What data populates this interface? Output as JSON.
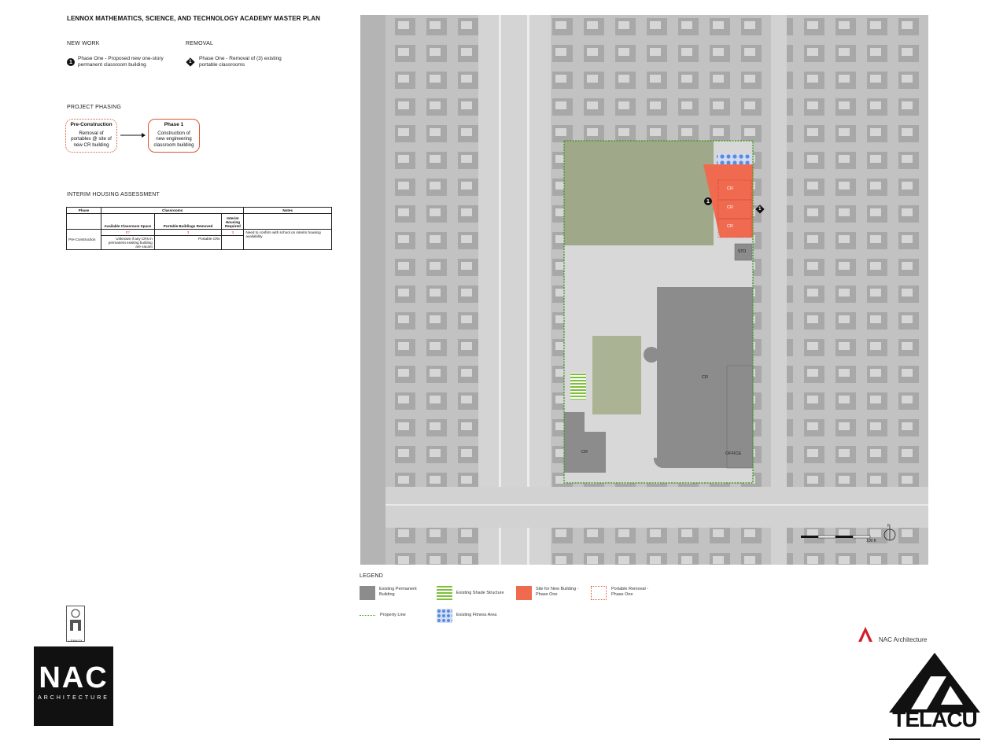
{
  "header": {
    "title": "LENNOX MATHEMATICS, SCIENCE, AND TECHNOLOGY ACADEMY MASTER PLAN"
  },
  "new_work": {
    "heading": "NEW WORK",
    "badge": "1",
    "text_line1": "Phase One - Proposed new one-story",
    "text_line2": "permanent classroom building"
  },
  "removal": {
    "heading": "REMOVAL",
    "badge": "1",
    "text_line1": "Phase One - Removal of (3) existing",
    "text_line2": "portable classrooms"
  },
  "phasing": {
    "heading": "PROJECT PHASING",
    "pre": {
      "title": "Pre-Construction",
      "line1": "Removal of",
      "line2": "portables @ site of",
      "line3": "new CR building"
    },
    "phase1": {
      "title": "Phase 1",
      "line1": "Construction of",
      "line2": "new engineering",
      "line3": "classroom building"
    }
  },
  "interim": {
    "heading": "INTERIM HOUSING ASSESSMENT",
    "col_phase": "Phase",
    "col_classrooms": "Classrooms",
    "col_notes": "Notes",
    "sub_available": "Available Classroom Space",
    "sub_removed": "Portable Buildings Removed",
    "sub_interim": "Interim Housing Required",
    "row_phase": "Pre-Construction",
    "row_available_count": "0?",
    "row_removed_count": "3",
    "row_interim_count": "3",
    "row_available_note": "Unknown if any CRs in permanent existing building are vacant",
    "row_removed_note": "Portable CRs",
    "row_notes": "Need to confirm with school on interim housing availability"
  },
  "map": {
    "labels": {
      "cr_portable1": "CR",
      "cr_portable2": "CR",
      "cr_portable3": "CR",
      "sto": "STO",
      "cr_main": "CR",
      "office": "OFFICE",
      "cr_small": "CR"
    },
    "badge_circle": "1",
    "badge_diamond": "1",
    "scale_label": "100 ft",
    "north_label": "N"
  },
  "legend": {
    "heading": "LEGEND",
    "existing_building": "Existing Permanent Building",
    "shade": "Existing Shade Structure",
    "new_building": "Site for New Building - Phase One",
    "portable_removal": "Portable Removal - Phase One",
    "property_line": "Property Line",
    "fitness": "Existing Fitness Area"
  },
  "branding": {
    "lennox_text": "LENNOX",
    "nac_big": "NAC",
    "nac_small": "ARCHITECTURE",
    "nac_line": "NAC Architecture",
    "telacu": "TELACU"
  },
  "colors": {
    "new_building": "#ef6a4f",
    "shade": "#7cbf3a",
    "property_line": "#4a9a2c",
    "fitness": "#5b8be0",
    "existing_building": "#8c8c8c",
    "nac_red": "#d0202a"
  }
}
